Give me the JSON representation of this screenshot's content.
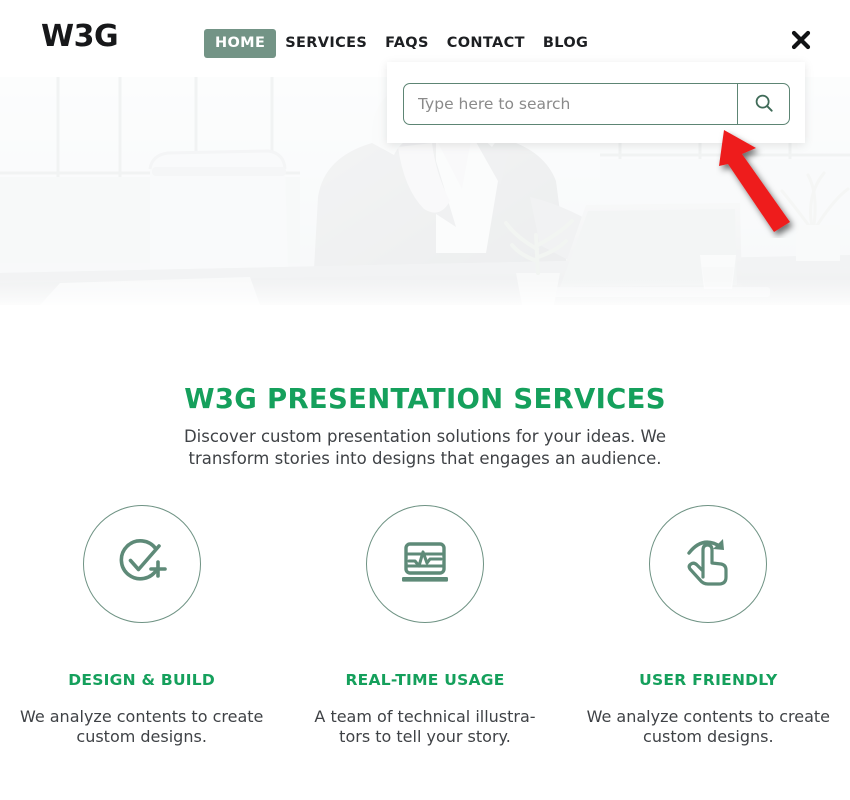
{
  "site": {
    "logo_text": "W3G",
    "accent_green": "#15a05c",
    "sage_green": "#739486",
    "border_green": "#5d8574",
    "annotation_red": "#ee1b1b"
  },
  "nav": {
    "items": [
      {
        "label": "HOME",
        "active": true
      },
      {
        "label": "SERVICES",
        "active": false
      },
      {
        "label": "FAQS",
        "active": false
      },
      {
        "label": "CONTACT",
        "active": false
      },
      {
        "label": "BLOG",
        "active": false
      }
    ],
    "close_icon": "close-x-icon"
  },
  "search": {
    "placeholder": "Type here to search",
    "value": "",
    "submit_icon": "magnifier-icon"
  },
  "annotation": {
    "type": "arrow",
    "direction": "up-left",
    "target": "search-submit-button",
    "color": "#ee1b1b"
  },
  "hero": {
    "alt": "businesswoman working at laptop on office desk"
  },
  "services": {
    "title": "W3G PRESENTATION SERVICES",
    "subtitle": "Discover custom presentation solutions for your ideas. We transform stories into designs that engages an audience.",
    "features": [
      {
        "icon": "check-circle-plus-icon",
        "title": "DESIGN & BUILD",
        "description": "We analyze contents to create custom designs."
      },
      {
        "icon": "laptop-chart-icon",
        "title": "REAL-TIME USAGE",
        "description": "A team of technical illustra-tors to tell your story."
      },
      {
        "icon": "hand-swipe-icon",
        "title": "USER FRIENDLY",
        "description": "We analyze contents to create custom designs."
      }
    ]
  }
}
